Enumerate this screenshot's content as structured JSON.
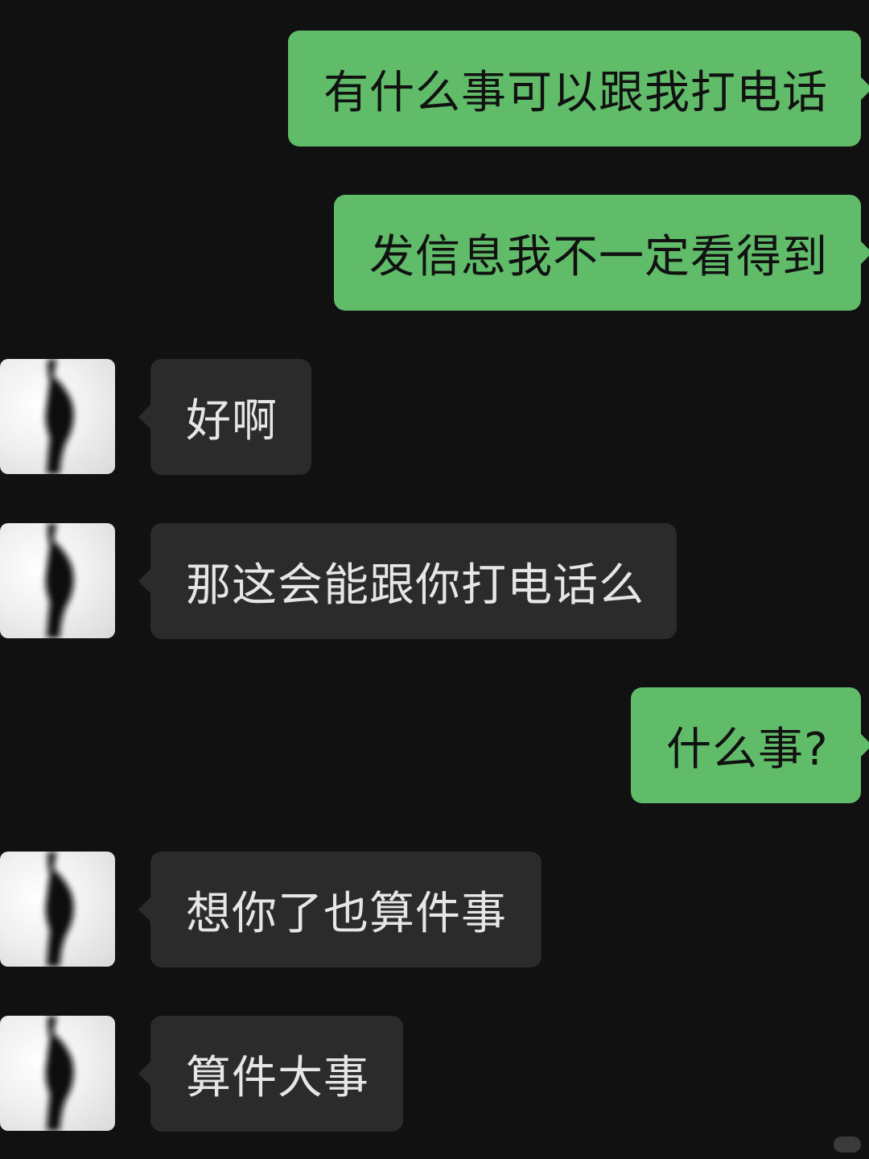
{
  "conversation": {
    "messages": [
      {
        "direction": "sent",
        "text": "有什么事可以跟我打电话"
      },
      {
        "direction": "sent",
        "text": "发信息我不一定看得到"
      },
      {
        "direction": "received",
        "text": "好啊"
      },
      {
        "direction": "received",
        "text": "那这会能跟你打电话么"
      },
      {
        "direction": "sent",
        "text": "什么事?"
      },
      {
        "direction": "received",
        "text": "想你了也算件事"
      },
      {
        "direction": "received",
        "text": "算件大事"
      }
    ]
  },
  "colors": {
    "background": "#111111",
    "sent_bubble": "#60bc69",
    "received_bubble": "#2b2b2b",
    "received_text": "#e6e6e6",
    "sent_text": "#111111"
  },
  "icons": {
    "avatar": "silhouette-avatar",
    "watermark": "xiaohongshu-watermark-icon"
  }
}
